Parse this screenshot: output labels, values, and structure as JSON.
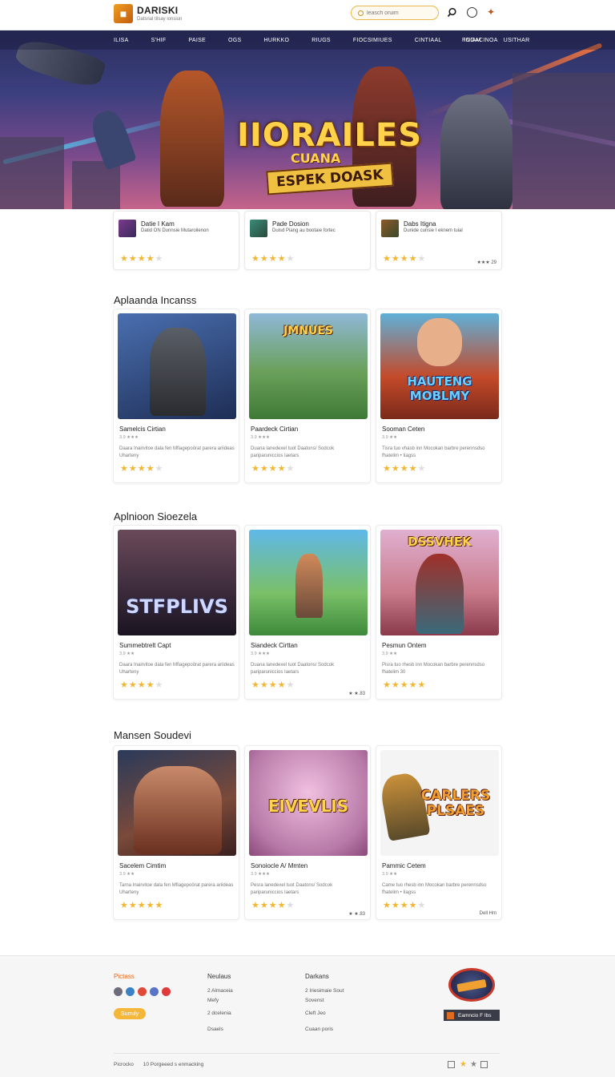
{
  "header": {
    "logo_glyph": "■",
    "brand": "DARISKI",
    "tagline": "Datsrial tilsay ionsiun",
    "search_placeholder": "leasch oruim",
    "accent": "#e8b84a"
  },
  "nav": [
    "ILISA",
    "S'HIF",
    "PAISE",
    "OGS",
    "HURKKO",
    "RIUGS",
    "FIOCSIMIUES",
    "CINTIAAL",
    "INIAM",
    "USITHAR",
    "FOGACINOA"
  ],
  "hero": {
    "title": "IIORAILES",
    "subtitle": "CUANA",
    "tag": "ESPEK DOASK"
  },
  "featured": [
    {
      "title": "Datie I Kam",
      "sub": "Datid ON Dunnsie Mutaroilenon",
      "rating": 4,
      "count": ""
    },
    {
      "title": "Pade Dosion",
      "sub": "Duisd Piang au bootaie fortec",
      "rating": 4,
      "count": ""
    },
    {
      "title": "Dabs Itigna",
      "sub": "Dunide cunsie I eknem tuial",
      "rating": 4,
      "count": "★★★ 29"
    }
  ],
  "sections": [
    {
      "title": "Aplaanda Incanss",
      "cards": [
        {
          "name": "Samelcis Cirtian",
          "meta": "3.9 ★★★",
          "desc": "Daara Inairvitoe dala fen Mfiagepoörat parera ariideas Uharteny",
          "rating": 4,
          "image_label": "",
          "count": ""
        },
        {
          "name": "Paardeck Cirtian",
          "meta": "3.9 ★★★",
          "desc": "Duana lanedexel tuot Daatons/ Sodcok pariparuniccios Iaetars",
          "rating": 4,
          "image_label": "JMNUES",
          "count": ""
        },
        {
          "name": "Sooman Ceten",
          "meta": "3.9 ★★",
          "desc": "Tisra tuo vhasb inn Mocokan barbre perennsdso fhatelim • Iiagss",
          "rating": 4,
          "image_label": "HAUTENG MOBLMY",
          "count": ""
        }
      ]
    },
    {
      "title": "Aplnioon Sioezela",
      "cards": [
        {
          "name": "Summebtrelt Capt",
          "meta": "3.9 ★★",
          "desc": "Daara Inairvitoe dala fen Mfiagepoörat parera ariideas Uharteny",
          "rating": 4,
          "image_label": "STFPLIVS",
          "count": ""
        },
        {
          "name": "Siandeck Cirttan",
          "meta": "3.9 ★★★",
          "desc": "Duana lanedexel tuot Daatons/ Sodcok pariparuniccios Iaetars",
          "rating": 4,
          "image_label": "",
          "count": "★ ★.83"
        },
        {
          "name": "Pesmun Ontem",
          "meta": "3.9 ★★",
          "desc": "Pisra tuo rhesb inn Mocokan barbre perennsdso fhatelim 30",
          "rating": 5,
          "image_label": "DSSVHEK",
          "count": ""
        }
      ]
    },
    {
      "title": "Mansen Soudevi",
      "cards": [
        {
          "name": "Sacelem Cimtim",
          "meta": "3.9 ★★",
          "desc": "Tarna Inairvitoe dala fen Mfiagepoörat parera ariideas Uharteny",
          "rating": 5,
          "image_label": "",
          "count": ""
        },
        {
          "name": "Sonoiocle A/ Mmten",
          "meta": "3.9 ★★★",
          "desc": "Pesra lanedexel tuot Daatons/ Sodcok pariparuniccios Iaetars",
          "rating": 4,
          "image_label": "EIVEVLIS",
          "count": "★ ★.83"
        },
        {
          "name": "Pammic Cetem",
          "meta": "3.9 ★★",
          "desc": "Came tuo rhesb inn Mocokan barbre perennsdso fhatelim • Iiagss",
          "rating": 4,
          "image_label": "CARLERS PLSAES",
          "count": "Dell Hm"
        }
      ]
    }
  ],
  "footer": {
    "brand_col": {
      "title": "Pictass",
      "subscribe": "Surruly"
    },
    "col2": {
      "title": "Neulaus",
      "links": [
        "2 Almaceia",
        "Mefy",
        "2 dcelenia",
        "Dsaels"
      ]
    },
    "col3": {
      "title": "Darkans",
      "links": [
        "2 Iriesimaie Sout",
        "Sovenst",
        "Cleft Jeo",
        "Cuaan poris"
      ]
    },
    "contact_label": "Eamncio F Ibs",
    "copyright_left": "Picrocko",
    "copyright_right": "10 Porgeeed s enmacking",
    "social_colors": [
      "#6c6c7a",
      "#3b82c4",
      "#e04a3a",
      "#5a72c8",
      "#e03a3a"
    ]
  }
}
